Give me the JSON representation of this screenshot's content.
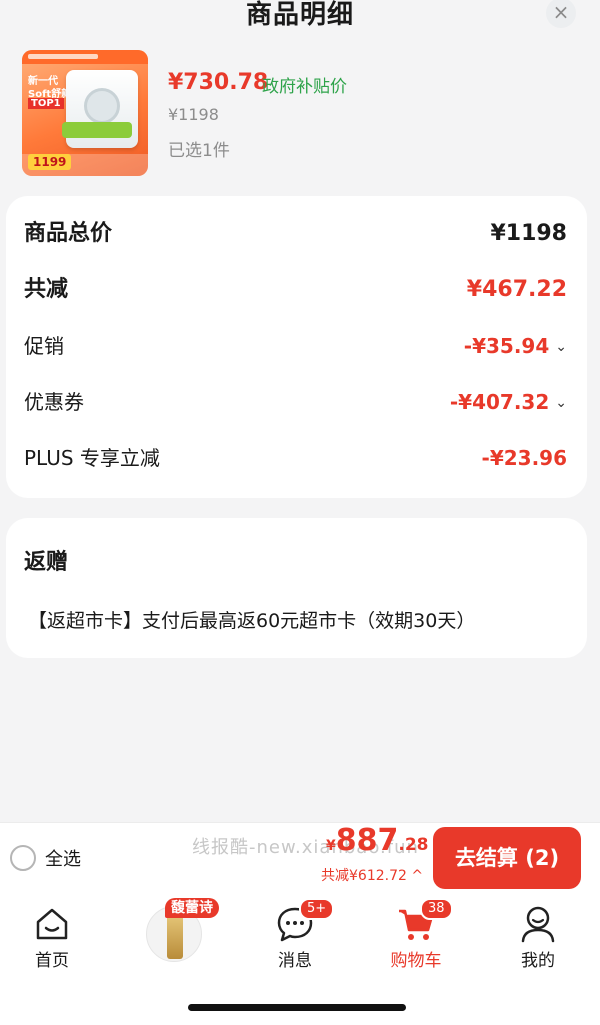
{
  "header": {
    "title": "商品明细",
    "close_icon": "×"
  },
  "product": {
    "image_name": "product-thumbnail",
    "image_text": {
      "line1": "新一代",
      "line2": "Soft舒新风",
      "top": "TOP1",
      "price": "1199"
    },
    "price": "¥730.78",
    "price_tag": "政府补贴价",
    "original_price": "¥1198",
    "quantity_text": "已选1件"
  },
  "price_detail": {
    "total": {
      "label": "商品总价",
      "value": "¥1198"
    },
    "reduced": {
      "label": "共减",
      "value": "¥467.22"
    },
    "promotion": {
      "label": "促销",
      "value": "-¥35.94"
    },
    "coupon": {
      "label": "优惠券",
      "value": "-¥407.32"
    },
    "plus": {
      "label": "PLUS 专享立减",
      "value": "-¥23.96"
    }
  },
  "gift": {
    "title": "返赠",
    "text": "【返超市卡】支付后最高返60元超市卡（效期30天）"
  },
  "checkout": {
    "select_all": "全选",
    "watermark": "线报酷-new.xianbao.fun",
    "amount_currency": "¥",
    "amount_int": "887",
    "amount_dec": ".28",
    "saved": "共减¥612.72 ^",
    "button": "去结算 (2)"
  },
  "tabbar": {
    "home": "首页",
    "promo_badge": "馥蕾诗",
    "messages": "消息",
    "messages_badge": "5+",
    "cart": "购物车",
    "cart_badge": "38",
    "me": "我的"
  },
  "colors": {
    "accent": "#e8392a",
    "green": "#2ea34a"
  }
}
